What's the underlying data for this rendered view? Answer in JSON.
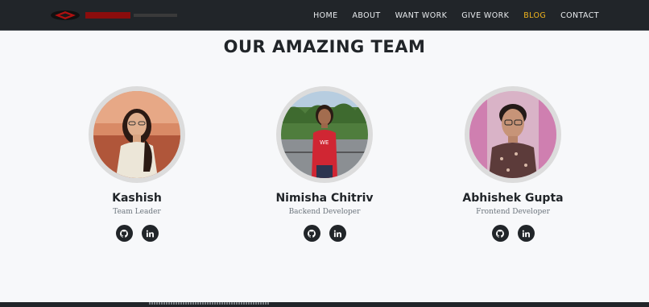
{
  "nav": {
    "logo_text": "KARAM",
    "links": [
      {
        "label": "HOME",
        "active": false
      },
      {
        "label": "ABOUT",
        "active": false
      },
      {
        "label": "WANT WORK",
        "active": false
      },
      {
        "label": "GIVE WORK",
        "active": false
      },
      {
        "label": "BLOG",
        "active": true
      },
      {
        "label": "CONTACT",
        "active": false
      }
    ],
    "active_color": "#f2b51d"
  },
  "section": {
    "title": "OUR AMAZING TEAM"
  },
  "team": [
    {
      "name": "Kashish",
      "role": "Team Leader",
      "socials": [
        "github-icon",
        "linkedin-icon"
      ]
    },
    {
      "name": "Nimisha Chitriv",
      "role": "Backend Developer",
      "socials": [
        "github-icon",
        "linkedin-icon"
      ]
    },
    {
      "name": "Abhishek Gupta",
      "role": "Frontend Developer",
      "socials": [
        "github-icon",
        "linkedin-icon"
      ]
    }
  ]
}
